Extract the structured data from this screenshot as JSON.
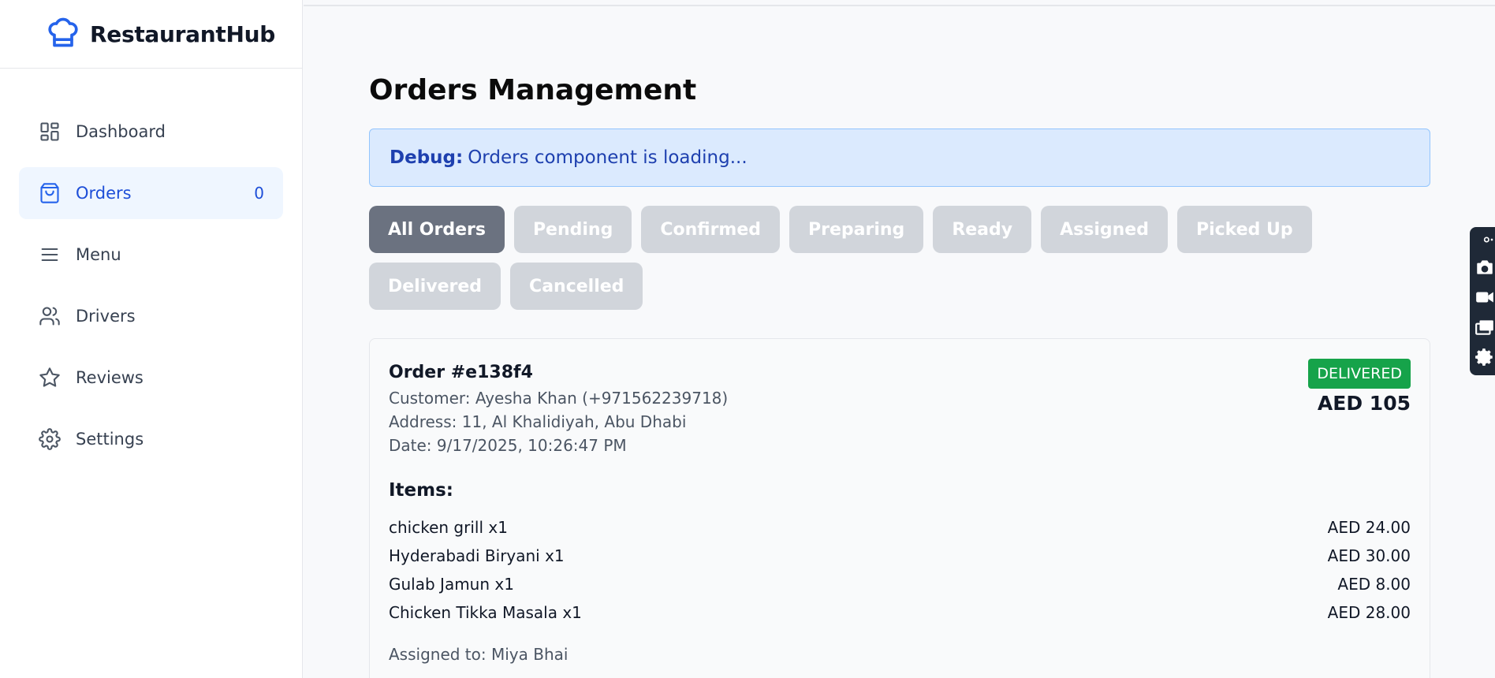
{
  "brand": {
    "name": "RestaurantHub"
  },
  "sidebar": {
    "items": [
      {
        "label": "Dashboard",
        "icon": "dashboard-icon"
      },
      {
        "label": "Orders",
        "icon": "shopping-bag-icon",
        "count": "0",
        "active": true
      },
      {
        "label": "Menu",
        "icon": "menu-icon"
      },
      {
        "label": "Drivers",
        "icon": "users-icon"
      },
      {
        "label": "Reviews",
        "icon": "star-icon"
      },
      {
        "label": "Settings",
        "icon": "gear-icon"
      }
    ]
  },
  "page": {
    "title": "Orders Management"
  },
  "debug": {
    "label": "Debug:",
    "message": "Orders component is loading..."
  },
  "filters": [
    "All Orders",
    "Pending",
    "Confirmed",
    "Preparing",
    "Ready",
    "Assigned",
    "Picked Up",
    "Delivered",
    "Cancelled"
  ],
  "order": {
    "id": "Order #e138f4",
    "customer": "Customer: Ayesha Khan (+971562239718)",
    "address": "Address: 11, Al Khalidiyah, Abu Dhabi",
    "date": "Date: 9/17/2025, 10:26:47 PM",
    "status": "DELIVERED",
    "total": "AED 105",
    "items_heading": "Items:",
    "items": [
      {
        "name": "chicken grill x1",
        "price": "AED 24.00"
      },
      {
        "name": "Hyderabadi Biryani x1",
        "price": "AED 30.00"
      },
      {
        "name": "Gulab Jamun x1",
        "price": "AED 8.00"
      },
      {
        "name": "Chicken Tikka Masala x1",
        "price": "AED 28.00"
      }
    ],
    "assigned": "Assigned to: Miya Bhai"
  },
  "colors": {
    "accent": "#2563eb",
    "status_delivered": "#16a34a",
    "debug_bg": "#dbeafe"
  }
}
